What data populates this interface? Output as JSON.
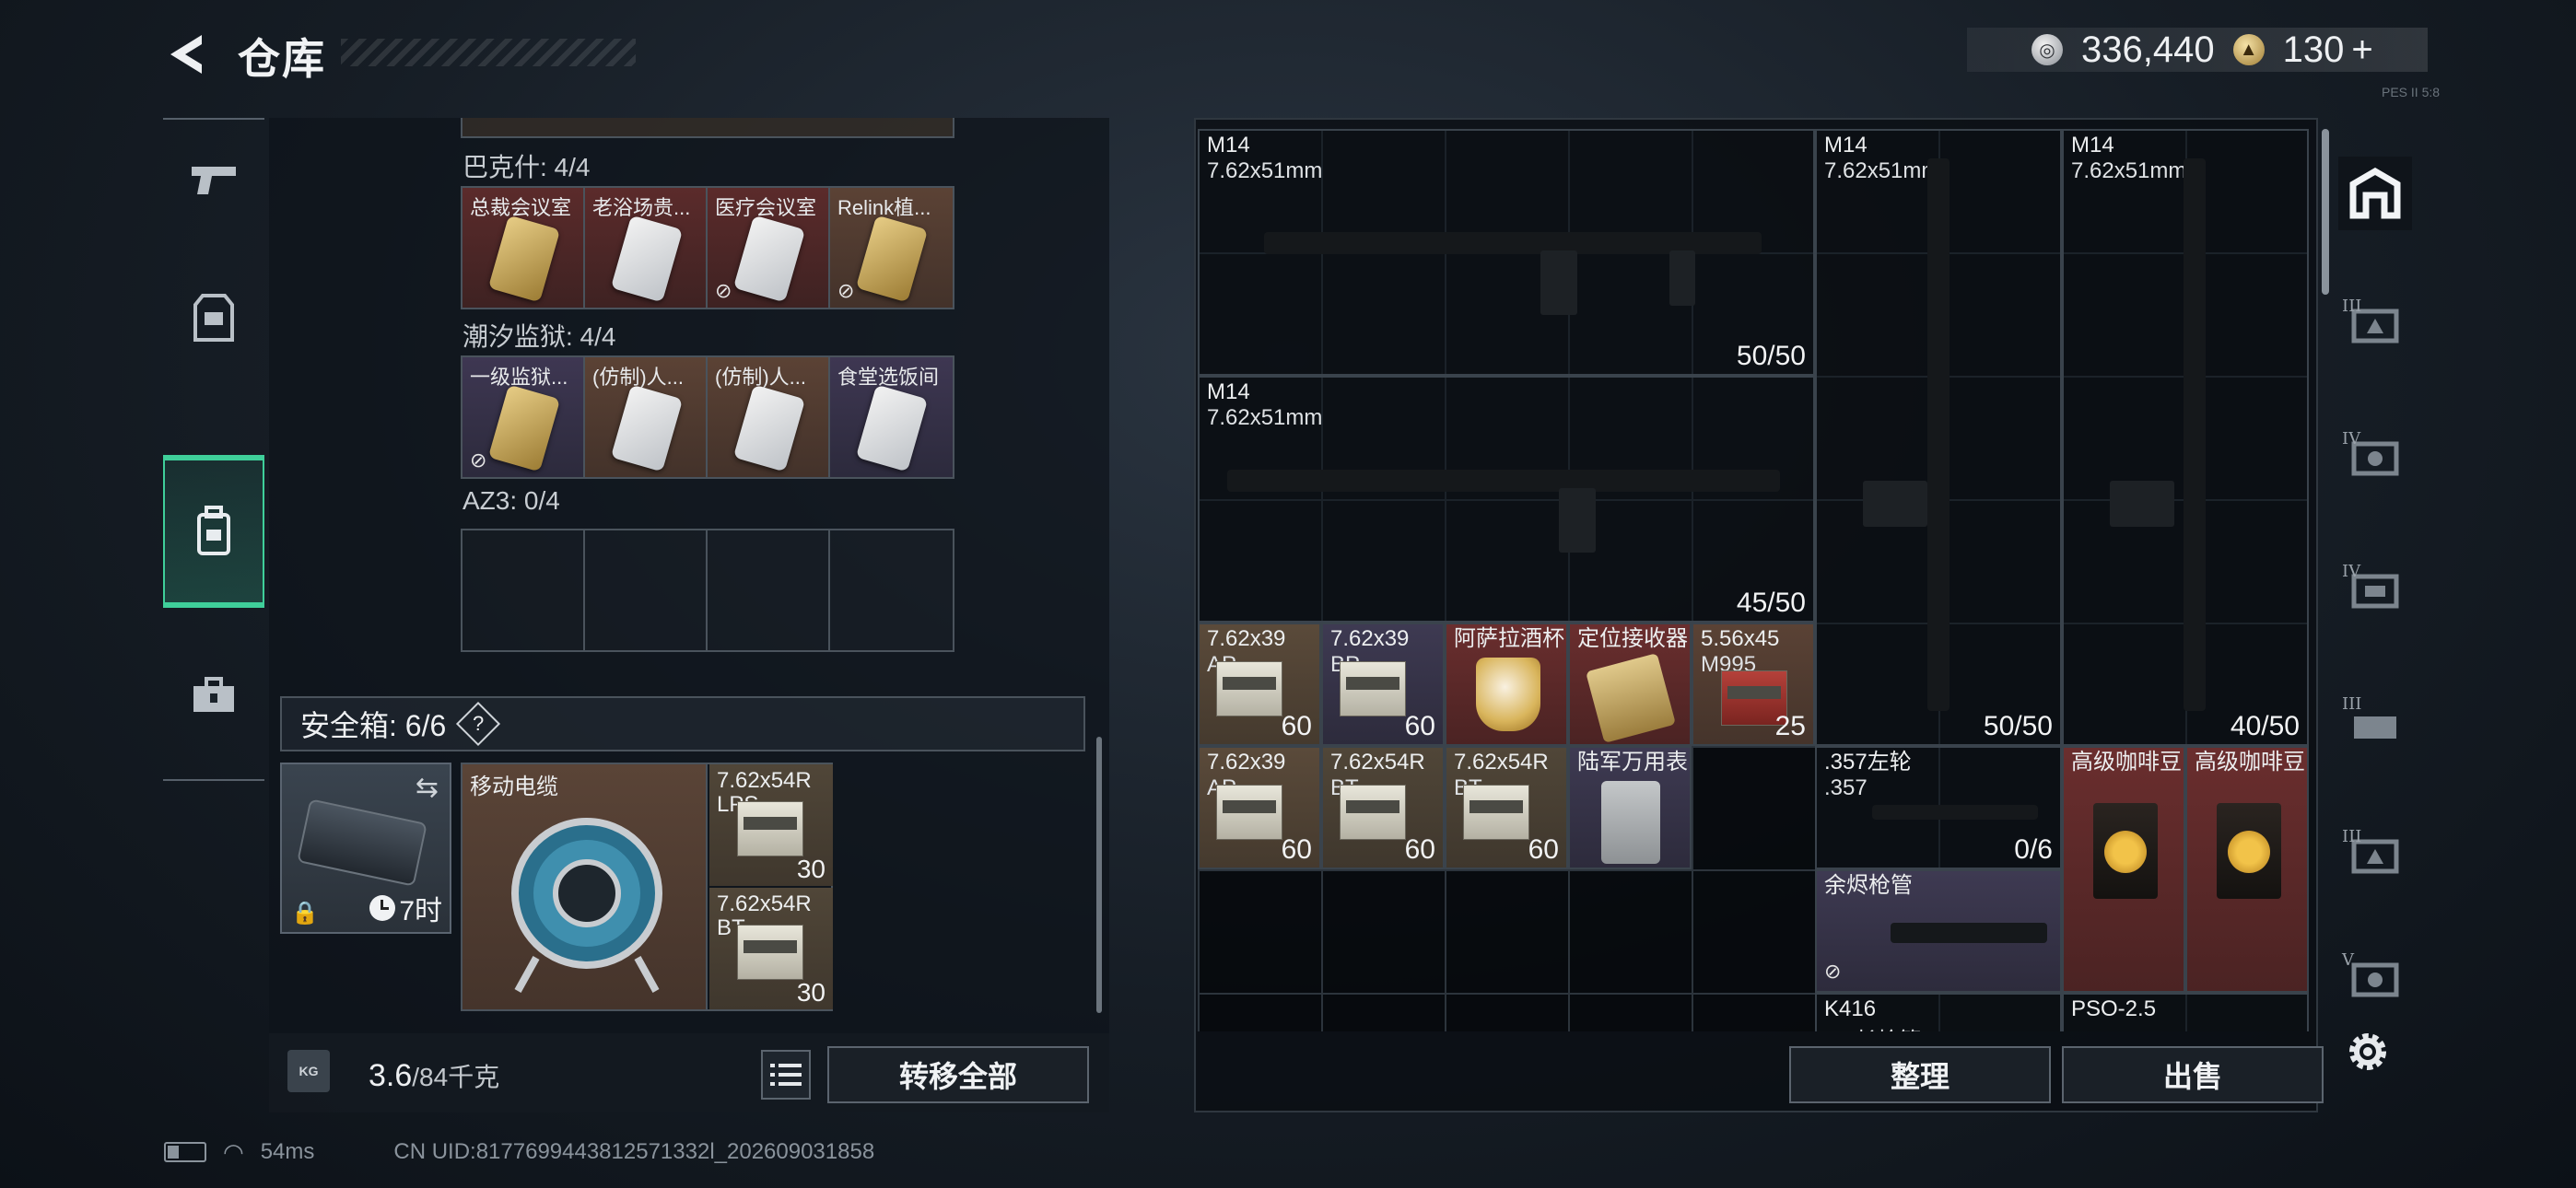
{
  "header": {
    "title": "仓库",
    "currency_silver": "336,440",
    "currency_gold": "130",
    "plus": "+",
    "corner_code": "PES II 5:8"
  },
  "left": {
    "groups": [
      {
        "label": "巴克什: 4/4",
        "cards": [
          {
            "name": "总裁会议室",
            "color": "red",
            "gold": true,
            "nolink": false
          },
          {
            "name": "老浴场贵...",
            "color": "red",
            "gold": false,
            "nolink": false
          },
          {
            "name": "医疗会议室",
            "color": "red",
            "gold": false,
            "nolink": true
          },
          {
            "name": "Relink植...",
            "color": "brown",
            "gold": true,
            "nolink": true
          }
        ]
      },
      {
        "label": "潮汐监狱: 4/4",
        "cards": [
          {
            "name": "一级监狱...",
            "color": "purple",
            "gold": true,
            "nolink": true
          },
          {
            "name": "(仿制)人...",
            "color": "brown",
            "gold": false,
            "nolink": false
          },
          {
            "name": "(仿制)人...",
            "color": "brown",
            "gold": false,
            "nolink": false
          },
          {
            "name": "食堂选饭间",
            "color": "purple",
            "gold": false,
            "nolink": false
          }
        ]
      },
      {
        "label": "AZ3: 0/4",
        "cards": []
      }
    ],
    "safe_label": "安全箱: 6/6",
    "safe_help": "?",
    "safe_timer": "7时",
    "safe_items": {
      "cable": {
        "name": "移动电缆"
      },
      "ammo1": {
        "name": "7.62x54R",
        "sub": "LPS",
        "count": "30"
      },
      "ammo2": {
        "name": "7.62x54R",
        "sub": "BT",
        "count": "30"
      }
    },
    "weight_icon": "KG",
    "weight_current": "3.6",
    "weight_max": "/84千克",
    "transfer_label": "转移全部"
  },
  "stash": {
    "weapons": [
      {
        "name": "M14",
        "caliber": "7.62x51mm",
        "count": "50/50"
      },
      {
        "name": "M14",
        "caliber": "7.62x51mm",
        "count": "45/50"
      },
      {
        "name": "M14",
        "caliber": "7.62x51mm",
        "count": "50/50"
      },
      {
        "name": "M14",
        "caliber": "7.62x51mm",
        "count": "40/50"
      }
    ],
    "small": [
      {
        "name": "7.62x39",
        "sub": "AP",
        "count": "60"
      },
      {
        "name": "7.62x39",
        "sub": "BP",
        "count": "60"
      },
      {
        "name": "阿萨拉酒杯",
        "sub": "",
        "count": ""
      },
      {
        "name": "定位接收器",
        "sub": "",
        "count": ""
      },
      {
        "name": "5.56x45",
        "sub": "M995",
        "count": "25"
      },
      {
        "name": "7.62x39",
        "sub": "AP",
        "count": "60"
      },
      {
        "name": "7.62x54R",
        "sub": "BT",
        "count": "60"
      },
      {
        "name": "7.62x54R",
        "sub": "BT",
        "count": "60"
      },
      {
        "name": "陆军万用表",
        "sub": "",
        "count": ""
      }
    ],
    "revolver": {
      "name": ".357左轮",
      "caliber": ".357",
      "count": "0/6"
    },
    "barrel": {
      "name": "余烬枪管"
    },
    "coffee": [
      {
        "name": "高级咖啡豆"
      },
      {
        "name": "高级咖啡豆"
      }
    ],
    "partial": [
      {
        "name": "K416",
        "sub": "AR长枪管"
      },
      {
        "name": "PSO-2.5"
      }
    ],
    "sort_label": "整理",
    "sell_label": "出售",
    "tab_numerals": [
      "III",
      "IV",
      "IV",
      "III",
      "III",
      "V"
    ]
  },
  "status": {
    "ping": "54ms",
    "uid": "CN UID:8177699443812571332l_202609031858"
  }
}
